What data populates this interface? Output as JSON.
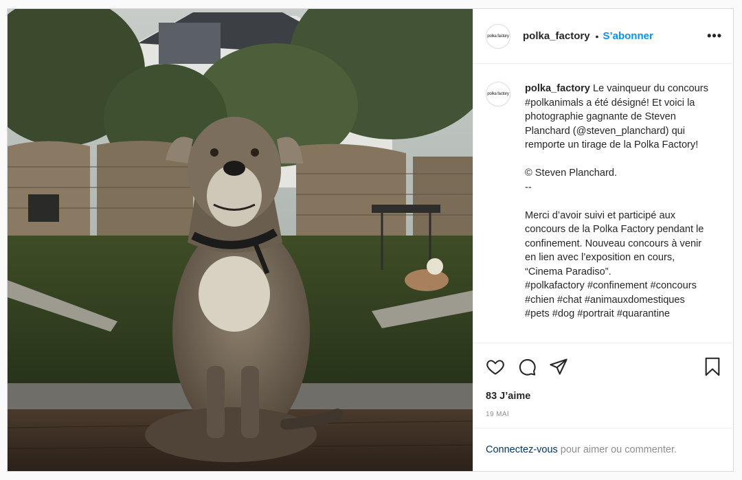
{
  "post": {
    "username": "polka_factory",
    "follow_label": "S’abonner",
    "avatar_text": "polka factory",
    "caption_author": "polka_factory",
    "caption_paragraphs": [
      "Le vainqueur du concours #polkanimals a été désigné! Et voici la photographie gagnante de Steven Planchard (@steven_planchard) qui remporte un tirage de la Polka Factory!",
      "© Steven Planchard.\n--",
      "Merci d’avoir suivi et participé aux concours de la Polka Factory pendant le confinement. Nouveau concours à venir en lien avec l’exposition en cours, “Cinema Paradiso”.\n#polkafactory #confinement #concours #chien #chat #animauxdomestiques #pets #dog #portrait #quarantine"
    ],
    "likes": "83 J’aime",
    "date": "19 MAI",
    "login_link": "Connectez-vous",
    "login_text": "pour aimer ou commenter."
  },
  "icons": {
    "more": "more-options-icon",
    "like": "heart-icon",
    "comment": "comment-icon",
    "share": "share-icon",
    "save": "bookmark-icon"
  },
  "colors": {
    "accent": "#0095f6",
    "link": "#00376b",
    "muted": "#8e8e8e",
    "border": "#dbdbdb"
  }
}
